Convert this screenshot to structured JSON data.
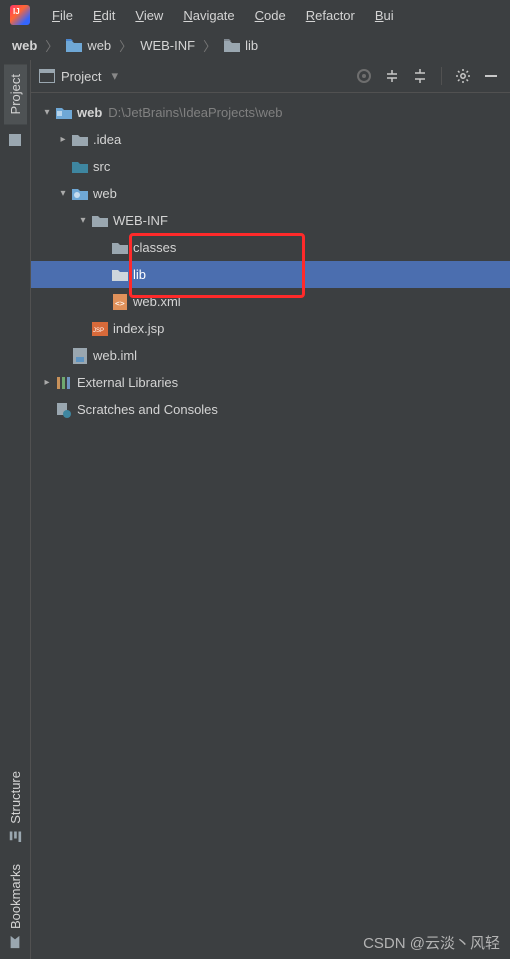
{
  "menu": {
    "items": [
      "File",
      "Edit",
      "View",
      "Navigate",
      "Code",
      "Refactor",
      "Bui"
    ]
  },
  "breadcrumb": {
    "parts": [
      "web",
      "web",
      "WEB-INF",
      "lib"
    ]
  },
  "project_panel": {
    "title": "Project"
  },
  "tree": {
    "root": {
      "label": "web",
      "path": "D:\\JetBrains\\IdeaProjects\\web"
    },
    "idea": ".idea",
    "src": "src",
    "webmod": "web",
    "webinf": "WEB-INF",
    "classes": "classes",
    "lib": "lib",
    "webxml": "web.xml",
    "indexjsp": "index.jsp",
    "webiml": "web.iml",
    "extlib": "External Libraries",
    "scratches": "Scratches and Consoles"
  },
  "sidebar": {
    "project": "Project",
    "structure": "Structure",
    "bookmarks": "Bookmarks"
  },
  "watermark": "CSDN @云淡丶风轻"
}
